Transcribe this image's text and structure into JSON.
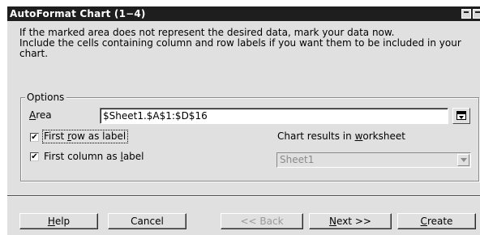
{
  "window": {
    "title": "AutoFormat Chart (1−4)",
    "controls": [
      "minimize-icon",
      "close-icon"
    ]
  },
  "intro": {
    "line1": "If the marked area does not represent the desired data, mark your data now.",
    "line2": "Include the cells containing column and row labels if you want them to be included in your",
    "line3": "chart."
  },
  "options": {
    "legend": "Options",
    "area_label_mnemonic": "A",
    "area_label_rest": "rea",
    "area_value": "$Sheet1.$A$1:$D$16",
    "shrink_icon": "shrink-icon",
    "first_row": {
      "checked": true,
      "check_glyph": "✔",
      "label_pre": "First ",
      "label_mnemonic": "r",
      "label_post": "ow as label"
    },
    "first_column": {
      "checked": true,
      "check_glyph": "✔",
      "label_pre": "First column as ",
      "label_mnemonic": "l",
      "label_post": "abel"
    },
    "results_label_pre": "Chart results in ",
    "results_label_mnemonic": "w",
    "results_label_post": "orksheet",
    "results_value": "Sheet1"
  },
  "buttons": {
    "help_mnemonic": "H",
    "help_rest": "elp",
    "cancel": "Cancel",
    "back": "<< Back",
    "next_mnemonic": "N",
    "next_rest": "ext >>",
    "create_mnemonic": "C",
    "create_rest": "reate"
  },
  "colors": {
    "dialog_bg": "#e0e0e0",
    "titlebar_bg": "#1e1e1e",
    "disabled_text": "#9a9a9a"
  }
}
